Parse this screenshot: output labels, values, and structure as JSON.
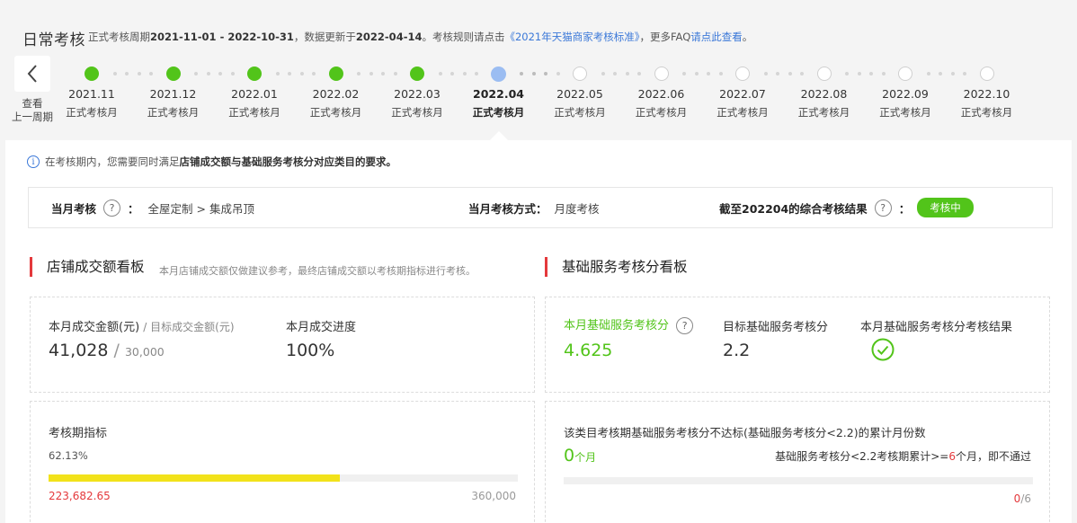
{
  "header": {
    "title": "日常考核",
    "desc_prefix": "正式考核周期",
    "period": "2021-11-01 - 2022-10-31",
    "desc_mid": "，数据更新于",
    "update_date": "2022-04-14",
    "desc_rule": "。考核规则请点击",
    "rule_link": "《2021年天猫商家考核标准》",
    "desc_faq": "，更多FAQ",
    "faq_link": "请点此查看",
    "desc_end": "。",
    "prev_label_1": "查看",
    "prev_label_2": "上一周期"
  },
  "timeline": {
    "months": [
      {
        "month": "2021.11",
        "label": "正式考核月",
        "state": "done"
      },
      {
        "month": "2021.12",
        "label": "正式考核月",
        "state": "done"
      },
      {
        "month": "2022.01",
        "label": "正式考核月",
        "state": "done"
      },
      {
        "month": "2022.02",
        "label": "正式考核月",
        "state": "done"
      },
      {
        "month": "2022.03",
        "label": "正式考核月",
        "state": "done"
      },
      {
        "month": "2022.04",
        "label": "正式考核月",
        "state": "current"
      },
      {
        "month": "2022.05",
        "label": "正式考核月",
        "state": "future"
      },
      {
        "month": "2022.06",
        "label": "正式考核月",
        "state": "future"
      },
      {
        "month": "2022.07",
        "label": "正式考核月",
        "state": "future"
      },
      {
        "month": "2022.08",
        "label": "正式考核月",
        "state": "future"
      },
      {
        "month": "2022.09",
        "label": "正式考核月",
        "state": "future"
      },
      {
        "month": "2022.10",
        "label": "正式考核月",
        "state": "future"
      }
    ]
  },
  "notice": {
    "prefix": "在考核期内，您需要同时满足",
    "bold": "店铺成交额与基础服务考核分对应类目的要求。"
  },
  "summary": {
    "month_assess_key": "当月考核",
    "month_assess_val": "全屋定制 > 集成吊顶",
    "method_key": "当月考核方式：",
    "method_val": "月度考核",
    "result_key": "截至202204的综合考核结果",
    "result_status": "考核中"
  },
  "sales": {
    "title": "店铺成交额看板",
    "note": "本月店铺成交额仅做建议参考，最终店铺成交额以考核期指标进行考核。",
    "amount_label": "本月成交金额(元)",
    "target_label": "/ 目标成交金额(元)",
    "amount": "41,028",
    "target": "30,000",
    "progress_label": "本月成交进度",
    "progress_value": "100%",
    "period_label": "考核期指标",
    "period_percent": "62.13%",
    "period_fraction": 0.6213,
    "period_current": "223,682.65",
    "period_target": "360,000"
  },
  "service": {
    "title": "基础服务考核分看板",
    "score_label": "本月基础服务考核分",
    "score": "4.625",
    "target_label": "目标基础服务考核分",
    "target": "2.2",
    "result_label": "本月基础服务考核分考核结果",
    "fail_title": "该类目考核期基础服务考核分不达标(基础服务考核分<2.2)的累计月份数",
    "fail_count": "0",
    "fail_unit": "个月",
    "rule_prefix": "基础服务考核分<2.2考核期累计>=",
    "rule_num": "6",
    "rule_suffix": "个月，即不通过",
    "ratio_num": "0",
    "ratio_den": "/6",
    "fail_fraction": 0
  },
  "colors": {
    "done": "#52c41a",
    "current": "#9bbdf2",
    "accent_red": "#e4393c",
    "link_blue": "#3b78d8",
    "progress_yellow": "#f2e21a"
  }
}
